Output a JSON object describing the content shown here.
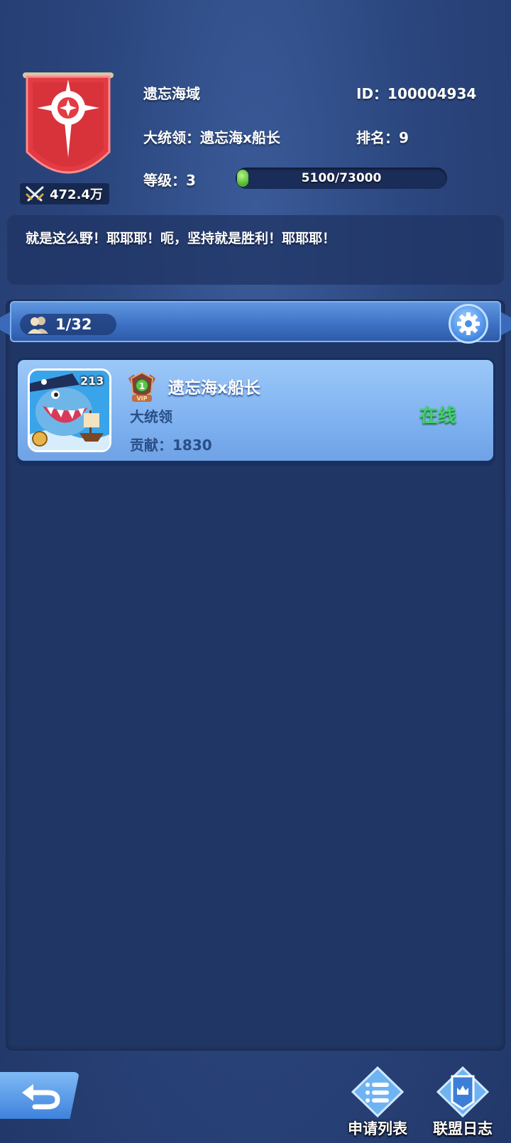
{
  "alliance": {
    "name": "遗忘海域",
    "id_label": "ID：100004934",
    "leader_label": "大统领：遗忘海x船长",
    "rank_label": "排名：9",
    "level_label": "等级：3",
    "xp_text": "5100/73000",
    "xp_current": 5100,
    "xp_max": 73000,
    "power": "472.4万",
    "motto": "就是这么野！耶耶耶！呃，坚持就是胜利！耶耶耶！"
  },
  "members_header": {
    "count": "1/32"
  },
  "members": [
    {
      "level": "213",
      "vip_level": "1",
      "vip_text": "VIP",
      "name": "遗忘海x船长",
      "role": "大统领",
      "contribution": "贡献：1830",
      "status": "在线"
    }
  ],
  "bottom_nav": {
    "apply_list": "申请列表",
    "alliance_log": "联盟日志"
  },
  "colors": {
    "background": "#2b467e",
    "online": "#3fd26a",
    "banner_red": "#e0343c",
    "card_blue": "#8fbef5"
  }
}
